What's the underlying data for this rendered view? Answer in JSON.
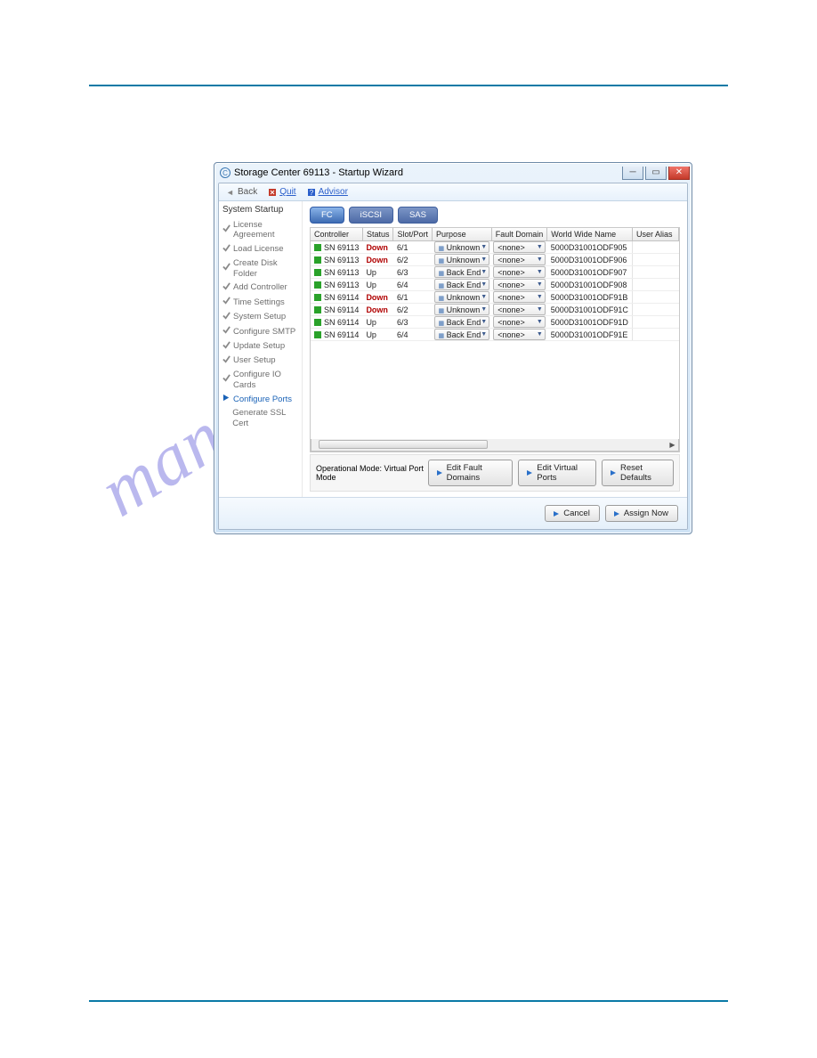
{
  "page": {
    "rule_color": "#0a7aa6"
  },
  "window": {
    "title": "Storage Center 69113 - Startup Wizard",
    "toolbar": {
      "back_label": "Back",
      "quit_label": "Quit",
      "advisor_label": "Advisor"
    }
  },
  "sidebar": {
    "heading": "System Startup",
    "items": [
      {
        "label": "License Agreement",
        "state": "done"
      },
      {
        "label": "Load License",
        "state": "done"
      },
      {
        "label": "Create Disk Folder",
        "state": "done"
      },
      {
        "label": "Add Controller",
        "state": "done"
      },
      {
        "label": "Time Settings",
        "state": "done"
      },
      {
        "label": "System Setup",
        "state": "done"
      },
      {
        "label": "Configure SMTP",
        "state": "done"
      },
      {
        "label": "Update Setup",
        "state": "done"
      },
      {
        "label": "User Setup",
        "state": "done"
      },
      {
        "label": "Configure IO Cards",
        "state": "done"
      },
      {
        "label": "Configure Ports",
        "state": "active"
      },
      {
        "label": "Generate SSL Cert",
        "state": "pending"
      }
    ]
  },
  "tabs": {
    "items": [
      {
        "label": "FC",
        "selected": true
      },
      {
        "label": "iSCSI",
        "selected": false
      },
      {
        "label": "SAS",
        "selected": false
      }
    ]
  },
  "table": {
    "headers": {
      "controller": "Controller",
      "status": "Status",
      "slotport": "Slot/Port",
      "purpose": "Purpose",
      "faultdomain": "Fault Domain",
      "wwn": "World Wide Name",
      "alias": "User Alias"
    },
    "rows": [
      {
        "controller": "SN 69113",
        "status": "Down",
        "status_class": "down",
        "slotport": "6/1",
        "purpose": "Unknown",
        "fd": "<none>",
        "wwn": "5000D31001ODF905",
        "alias": ""
      },
      {
        "controller": "SN 69113",
        "status": "Down",
        "status_class": "down",
        "slotport": "6/2",
        "purpose": "Unknown",
        "fd": "<none>",
        "wwn": "5000D31001ODF906",
        "alias": ""
      },
      {
        "controller": "SN 69113",
        "status": "Up",
        "status_class": "up",
        "slotport": "6/3",
        "purpose": "Back End",
        "fd": "<none>",
        "wwn": "5000D31001ODF907",
        "alias": ""
      },
      {
        "controller": "SN 69113",
        "status": "Up",
        "status_class": "up",
        "slotport": "6/4",
        "purpose": "Back End",
        "fd": "<none>",
        "wwn": "5000D31001ODF908",
        "alias": ""
      },
      {
        "controller": "SN 69114",
        "status": "Down",
        "status_class": "down",
        "slotport": "6/1",
        "purpose": "Unknown",
        "fd": "<none>",
        "wwn": "5000D31001ODF91B",
        "alias": ""
      },
      {
        "controller": "SN 69114",
        "status": "Down",
        "status_class": "down",
        "slotport": "6/2",
        "purpose": "Unknown",
        "fd": "<none>",
        "wwn": "5000D31001ODF91C",
        "alias": ""
      },
      {
        "controller": "SN 69114",
        "status": "Up",
        "status_class": "up",
        "slotport": "6/3",
        "purpose": "Back End",
        "fd": "<none>",
        "wwn": "5000D31001ODF91D",
        "alias": ""
      },
      {
        "controller": "SN 69114",
        "status": "Up",
        "status_class": "up",
        "slotport": "6/4",
        "purpose": "Back End",
        "fd": "<none>",
        "wwn": "5000D31001ODF91E",
        "alias": ""
      }
    ]
  },
  "op_mode": {
    "label": "Operational Mode: Virtual Port Mode"
  },
  "buttons": {
    "edit_fault": "Edit Fault Domains",
    "edit_virtual": "Edit Virtual Ports",
    "reset_defaults": "Reset Defaults",
    "cancel": "Cancel",
    "assign": "Assign Now"
  },
  "watermark": "manualshive.com"
}
